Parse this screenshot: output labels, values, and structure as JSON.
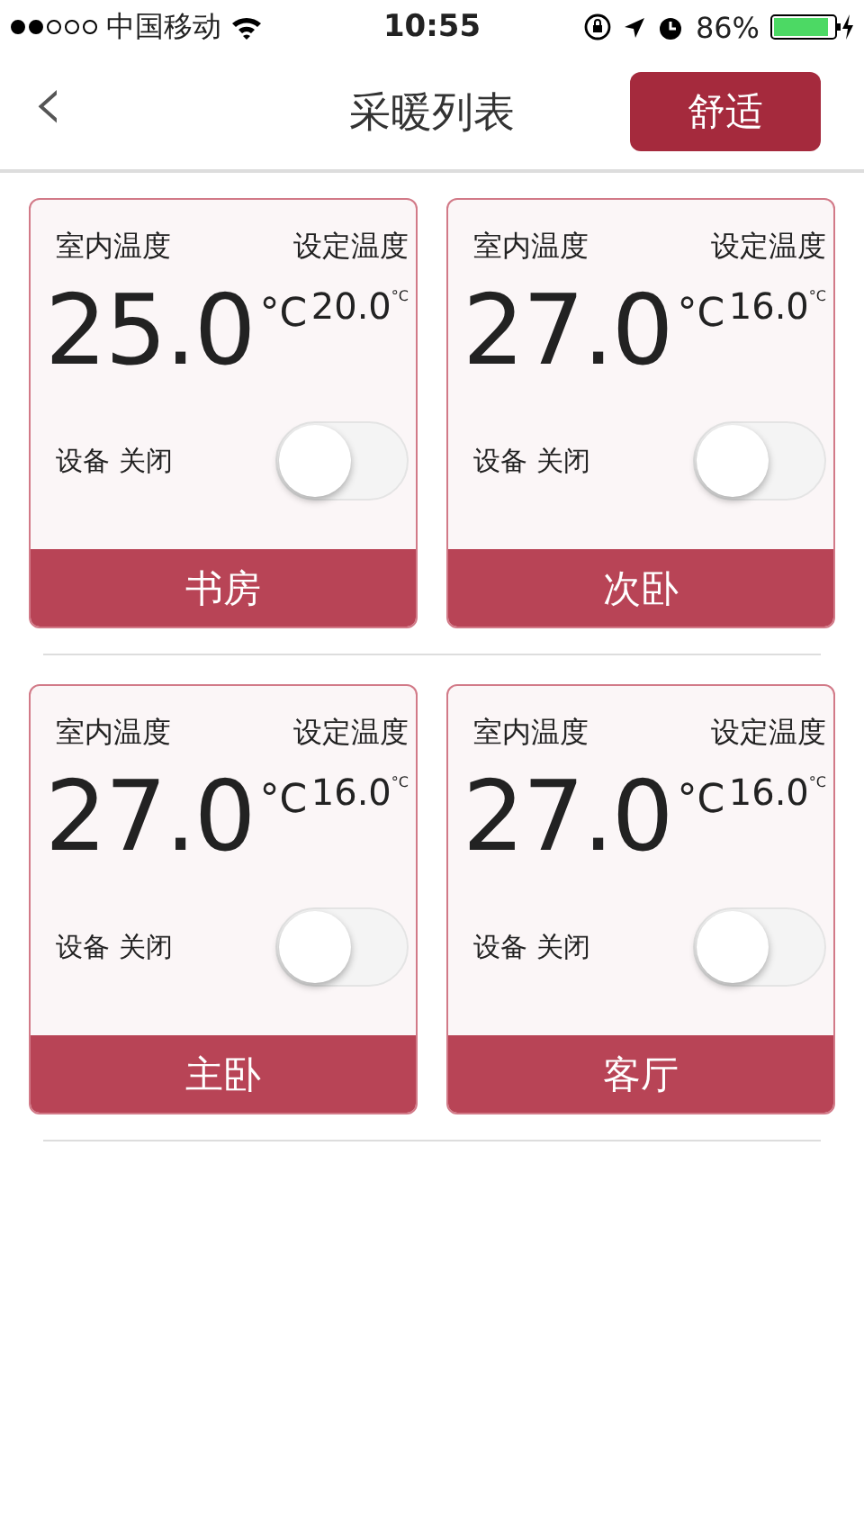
{
  "status_bar": {
    "carrier": "中国移动",
    "time": "10:55",
    "battery": "86%"
  },
  "nav": {
    "back": "‹",
    "title": "采暖列表",
    "mode_button": "舒适"
  },
  "rooms": [
    {
      "indoor_label": "室内温度",
      "indoor_temp": "25.0",
      "indoor_unit": "°C",
      "set_label": "设定温度",
      "set_temp": "20.0",
      "set_unit": "°C",
      "device_status": "设备 关闭",
      "on": false,
      "name": "书房"
    },
    {
      "indoor_label": "室内温度",
      "indoor_temp": "27.0",
      "indoor_unit": "°C",
      "set_label": "设定温度",
      "set_temp": "16.0",
      "set_unit": "°C",
      "device_status": "设备 关闭",
      "on": false,
      "name": "次卧"
    },
    {
      "indoor_label": "室内温度",
      "indoor_temp": "27.0",
      "indoor_unit": "°C",
      "set_label": "设定温度",
      "set_temp": "16.0",
      "set_unit": "°C",
      "device_status": "设备 关闭",
      "on": false,
      "name": "主卧"
    },
    {
      "indoor_label": "室内温度",
      "indoor_temp": "27.0",
      "indoor_unit": "°C",
      "set_label": "设定温度",
      "set_temp": "16.0",
      "set_unit": "°C",
      "device_status": "设备 关闭",
      "on": false,
      "name": "客厅"
    }
  ]
}
